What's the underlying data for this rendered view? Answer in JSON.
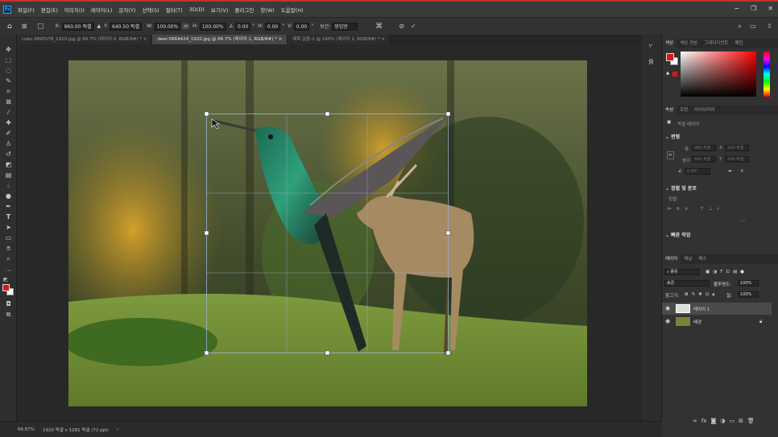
{
  "menu": {
    "app_icon": "Ps",
    "items": [
      "파일(F)",
      "편집(E)",
      "이미지(I)",
      "레이어(L)",
      "문자(Y)",
      "선택(S)",
      "필터(T)",
      "3D(D)",
      "보기(V)",
      "플러그인",
      "창(W)",
      "도움말(H)"
    ],
    "window_controls": [
      "−",
      "❐",
      "✕"
    ]
  },
  "options": {
    "x_label": "X:",
    "x_value": "960.00 픽셀",
    "y_label": "Y:",
    "y_value": "640.50 픽셀",
    "w_label": "W:",
    "w_value": "100.00%",
    "h_label": "H:",
    "h_value": "100.00%",
    "angle_value": "0.00",
    "deg": "°",
    "hskew_label": "H:",
    "hskew_value": "0.00",
    "vskew_label": "V:",
    "vskew_value": "0.00",
    "interp_label": "보간:",
    "interp_value": "쌍입방",
    "icons": [
      "home-icon",
      "reference-point-icon",
      "delta-icon",
      "link-icon",
      "angle-icon",
      "warp-icon",
      "cancel-icon",
      "commit-icon",
      "search-icon",
      "workspace-icon",
      "share-icon"
    ]
  },
  "tabs": [
    {
      "label": "cubs-3895578_1920.jpg @ 66.7% (레이어 0, RGB/8#) *",
      "close": "×"
    },
    {
      "label": "deer-5664424_1920.jpg @ 66.7% (레이어 1, RGB/8#) *",
      "close": "×"
    },
    {
      "label": "제목 없음-1 @ 100% (레이어 1, RGB/8#) *",
      "close": "×"
    }
  ],
  "status": {
    "zoom": "66.67%",
    "doc": "1920 픽셀 x 1281 픽셀 (72 ppi)",
    "arrow": "›"
  },
  "panel_color": {
    "tabs": [
      "색상",
      "색상 견본",
      "그레이디언트",
      "패턴"
    ],
    "fg_color": "#e0141c",
    "bg_color": "#ffffff"
  },
  "panel_props": {
    "tabs": [
      "속성",
      "조정",
      "라이브러리"
    ],
    "pixel_layer": "픽셀 레이어",
    "transform_title": "변형",
    "w_label": "폭",
    "w_value": "960 픽셀",
    "x_label": "X",
    "x_value": "320 픽셀",
    "h_label": "높이",
    "h_value": "641 픽셀",
    "y_label": "Y",
    "y_value": "320 픽셀",
    "angle_value": "0.00°",
    "align_title": "정렬 및 분포",
    "align_label": "정렬:",
    "more": "···",
    "quick_title": "빠른 작업"
  },
  "panel_layers": {
    "tabs": [
      "레이어",
      "채널",
      "패스"
    ],
    "filter_kind": "종류",
    "blend_mode": "표준",
    "opacity_label": "불투명도:",
    "opacity_value": "100%",
    "lock_label": "잠그기:",
    "fill_label": "칠:",
    "fill_value": "100%",
    "layers": [
      {
        "name": "레이어 1",
        "visible_icon": "eye-icon",
        "selected": true
      },
      {
        "name": "배경",
        "visible_icon": "eye-icon",
        "locked": true
      }
    ],
    "footer_icons": [
      "link-layers-icon",
      "fx-icon",
      "mask-icon",
      "adjustment-icon",
      "group-icon",
      "new-layer-icon",
      "trash-icon"
    ]
  }
}
